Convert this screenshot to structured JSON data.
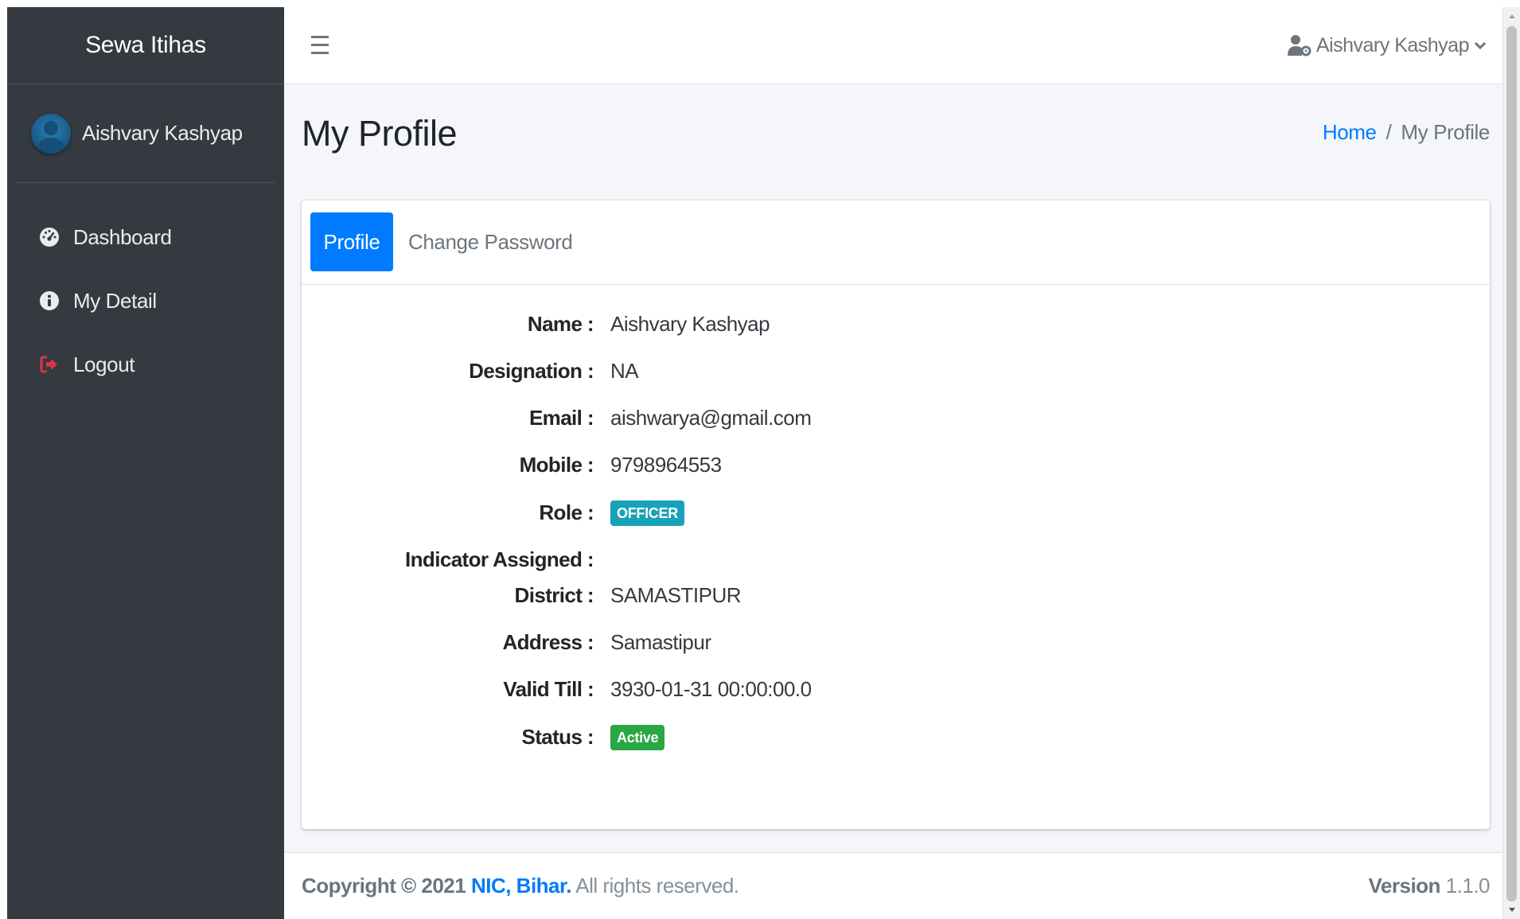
{
  "app": {
    "brand": "Sewa Itihas"
  },
  "sidebar": {
    "user_name": "Aishvary Kashyap",
    "items": [
      {
        "label": "Dashboard",
        "icon": "dashboard-icon"
      },
      {
        "label": "My Detail",
        "icon": "info-icon"
      },
      {
        "label": "Logout",
        "icon": "logout-icon"
      }
    ]
  },
  "topbar": {
    "user_menu_label": "Aishvary Kashyap"
  },
  "page": {
    "title": "My Profile",
    "breadcrumb": {
      "home": "Home",
      "separator": "/",
      "current": "My Profile"
    }
  },
  "tabs": {
    "profile": "Profile",
    "change_password": "Change Password"
  },
  "profile": {
    "name_label": "Name :",
    "name": "Aishvary Kashyap",
    "designation_label": "Designation :",
    "designation": "NA",
    "email_label": "Email :",
    "email": "aishwarya@gmail.com",
    "mobile_label": "Mobile :",
    "mobile": "9798964553",
    "role_label": "Role :",
    "role": "OFFICER",
    "indicator_label": "Indicator Assigned :",
    "district_label": "District :",
    "district": "SAMASTIPUR",
    "address_label": "Address :",
    "address": "Samastipur",
    "valid_till_label": "Valid Till :",
    "valid_till": "3930-01-31 00:00:00.0",
    "status_label": "Status :",
    "status": "Active"
  },
  "footer": {
    "copyright_prefix": "Copyright © 2021",
    "org": "NIC, Bihar.",
    "rights": "All rights reserved.",
    "version_label": "Version",
    "version": "1.1.0"
  },
  "colors": {
    "sidebar_bg": "#343a40",
    "primary": "#007bff",
    "info_badge": "#17a2b8",
    "success_badge": "#28a745",
    "logout_icon": "#dc3545"
  }
}
